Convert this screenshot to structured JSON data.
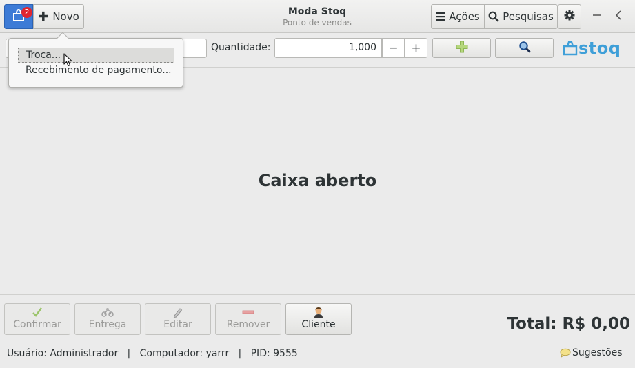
{
  "app": {
    "title": "Moda Stoq",
    "subtitle": "Ponto de vendas",
    "badge_count": "2",
    "accent_color": "#3d7bd6"
  },
  "header": {
    "new_label": "Novo",
    "actions_label": "Ações",
    "search_label": "Pesquisas",
    "icons": [
      "stoq-app-icon",
      "plus-icon",
      "hamburger-icon",
      "search-icon",
      "gear-icon",
      "minimize-icon",
      "back-chevron-icon"
    ]
  },
  "toolbar": {
    "code_value": "",
    "quantity_label": "Quantidade:",
    "quantity_value": "1,000",
    "minus_label": "−",
    "plus_label": "+",
    "logo_text": "stoq"
  },
  "popover": {
    "items": [
      {
        "label": "Troca..."
      },
      {
        "label": "Recebimento de pagamento..."
      }
    ]
  },
  "main": {
    "status_message": "Caixa aberto"
  },
  "actions": {
    "confirm_label": "Confirmar",
    "delivery_label": "Entrega",
    "edit_label": "Editar",
    "remove_label": "Remover",
    "client_label": "Cliente"
  },
  "total": {
    "text": "Total: R$ 0,00"
  },
  "statusbar": {
    "text": "Usuário: Administrador   |   Computador: yarrr   |   PID: 9555",
    "suggestions_label": "Sugestões"
  }
}
